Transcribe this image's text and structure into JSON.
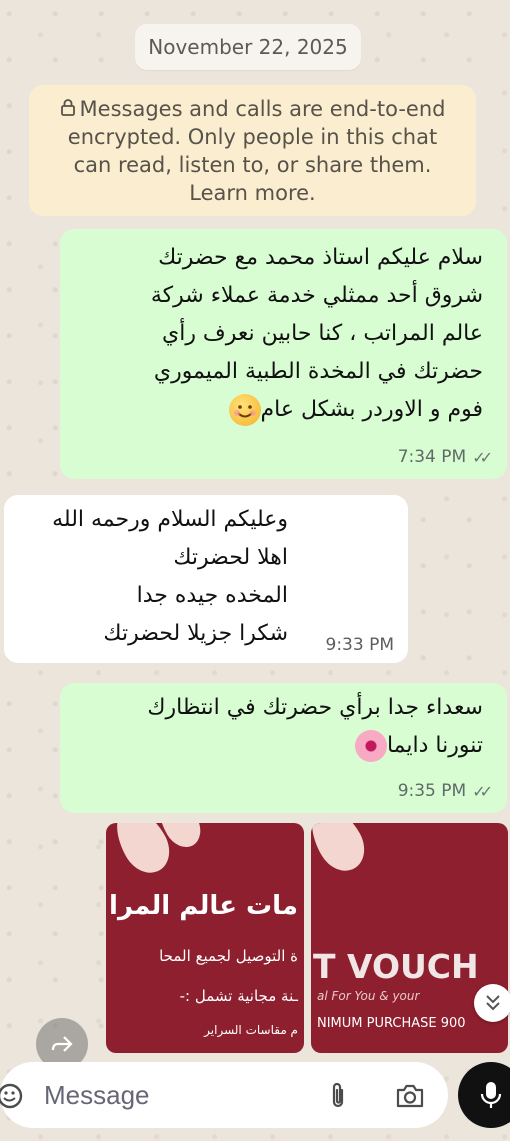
{
  "chat": {
    "date_chip": "November 22, 2025",
    "encryption_notice": "Messages and calls are end-to-end encrypted. Only people in this chat can read, listen to, or share them. Learn more.",
    "messages": [
      {
        "direction": "outgoing",
        "lines": [
          "سلام عليكم استاذ محمد مع حضرتك",
          "شروق أحد ممثلي خدمة عملاء شركة",
          "عالم المراتب ، كنا حابين نعرف رأي",
          "حضرتك في المخدة الطبية الميموري",
          "فوم و الاوردر بشكل عام"
        ],
        "emoji": "smiling-face",
        "time": "7:34 PM",
        "status": "read"
      },
      {
        "direction": "incoming",
        "lines": [
          "وعليكم السلام ورحمه الله",
          "اهلا لحضرتك",
          "المخده جيده جدا",
          "شكرا جزيلا لحضرتك"
        ],
        "time": "9:33 PM"
      },
      {
        "direction": "outgoing",
        "lines": [
          "سعداء جدا برأي حضرتك في انتظارك",
          "تنورنا دايما"
        ],
        "emoji": "cherry-blossom",
        "time": "9:35 PM",
        "status": "read"
      }
    ],
    "images": {
      "first": {
        "title": "مات عالم المرا",
        "line2": "ة التوصيل لجميع المحا",
        "line3": "ـنة مجانية تشمل :-",
        "line4": "م مقاسات السراير"
      },
      "second": {
        "title": "T VOUCH",
        "line2": "al For You & your",
        "line3": "NIMUM PURCHASE 900"
      }
    }
  },
  "composer": {
    "placeholder": "Message"
  },
  "icons": {
    "emoji_button": "emoji-icon",
    "attach": "paperclip-icon",
    "camera": "camera-icon",
    "mic": "mic-icon",
    "scroll_down": "double-chevron-down-icon",
    "forward": "forward-icon"
  },
  "colors": {
    "outgoing_bubble": "#d9fdd3",
    "incoming_bubble": "#ffffff",
    "notice_bg": "#fbeed0",
    "image_bg": "#8d1f2e"
  }
}
